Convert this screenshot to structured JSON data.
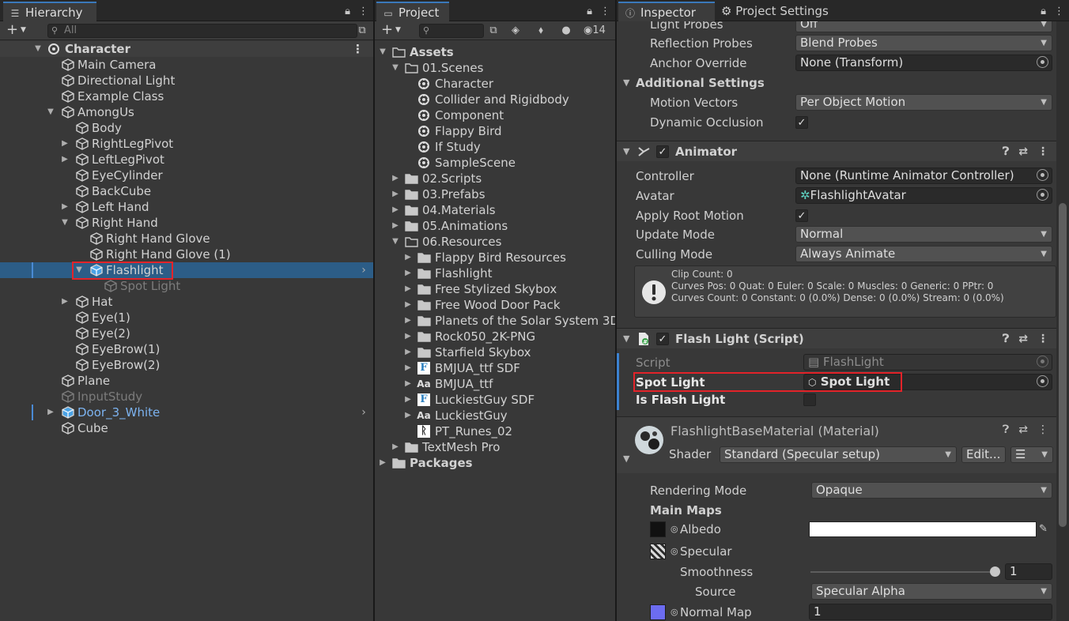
{
  "hierarchy": {
    "tab_label": "Hierarchy",
    "search_placeholder": "All",
    "rows": [
      "Character",
      "Main Camera",
      "Directional Light",
      "Example Class",
      "AmongUs",
      "Body",
      "RightLegPivot",
      "LeftLegPivot",
      "EyeCylinder",
      "BackCube",
      "Left Hand",
      "Right Hand",
      "Right Hand Glove",
      "Right Hand Glove (1)",
      "Flashlight",
      "Spot Light",
      "Hat",
      "Eye(1)",
      "Eye(2)",
      "EyeBrow(1)",
      "EyeBrow(2)",
      "Plane",
      "InputStudy",
      "Door_3_White",
      "Cube"
    ]
  },
  "project": {
    "tab_label": "Project",
    "badge_count": "14",
    "rows": [
      "Assets",
      "01.Scenes",
      "Character",
      "Collider and Rigidbody",
      "Component",
      "Flappy Bird",
      "If Study",
      "SampleScene",
      "02.Scripts",
      "03.Prefabs",
      "04.Materials",
      "05.Animations",
      "06.Resources",
      "Flappy Bird Resources",
      "Flashlight",
      "Free Stylized Skybox",
      "Free Wood Door Pack",
      "Planets of the Solar System 3D",
      "Rock050_2K-PNG",
      "Starfield Skybox",
      "BMJUA_ttf SDF",
      "BMJUA_ttf",
      "LuckiestGuy SDF",
      "LuckiestGuy",
      "PT_Runes_02",
      "TextMesh Pro",
      "Packages"
    ]
  },
  "inspector": {
    "tab_label": "Inspector",
    "tab2_label": "Project Settings",
    "light_probes": {
      "label": "Light Probes",
      "value": "Off"
    },
    "reflection_probes": {
      "label": "Reflection Probes",
      "value": "Blend Probes"
    },
    "anchor_override": {
      "label": "Anchor Override",
      "value": "None (Transform)"
    },
    "additional_settings": "Additional Settings",
    "motion_vectors": {
      "label": "Motion Vectors",
      "value": "Per Object Motion"
    },
    "dynamic_occlusion": {
      "label": "Dynamic Occlusion",
      "checked": "✓"
    },
    "animator": {
      "title": "Animator",
      "controller": {
        "label": "Controller",
        "value": "None (Runtime Animator Controller)"
      },
      "avatar": {
        "label": "Avatar",
        "value": "FlashlightAvatar"
      },
      "apply_root_motion": {
        "label": "Apply Root Motion",
        "checked": "✓"
      },
      "update_mode": {
        "label": "Update Mode",
        "value": "Normal"
      },
      "culling_mode": {
        "label": "Culling Mode",
        "value": "Always Animate"
      },
      "info_lines": [
        "Clip Count: 0",
        "Curves Pos: 0 Quat: 0 Euler: 0 Scale: 0 Muscles: 0 Generic: 0 PPtr: 0",
        "Curves Count: 0 Constant: 0 (0.0%) Dense: 0 (0.0%) Stream: 0 (0.0%)"
      ]
    },
    "flash_light": {
      "title": "Flash Light (Script)",
      "script": {
        "label": "Script",
        "value": "FlashLight"
      },
      "spot_light": {
        "label": "Spot Light",
        "value": "Spot Light"
      },
      "is_flash_light": {
        "label": "Is Flash Light"
      }
    },
    "material": {
      "title": "FlashlightBaseMaterial (Material)",
      "shader_label": "Shader",
      "shader_value": "Standard (Specular setup)",
      "edit_label": "Edit...",
      "rendering_mode": {
        "label": "Rendering Mode",
        "value": "Opaque"
      },
      "main_maps": "Main Maps",
      "albedo": "Albedo",
      "specular": "Specular",
      "smoothness": {
        "label": "Smoothness",
        "value": "1",
        "fraction": 1.0
      },
      "source": {
        "label": "Source",
        "value": "Specular Alpha"
      },
      "normal_map": {
        "label": "Normal Map",
        "value": "1"
      }
    }
  }
}
